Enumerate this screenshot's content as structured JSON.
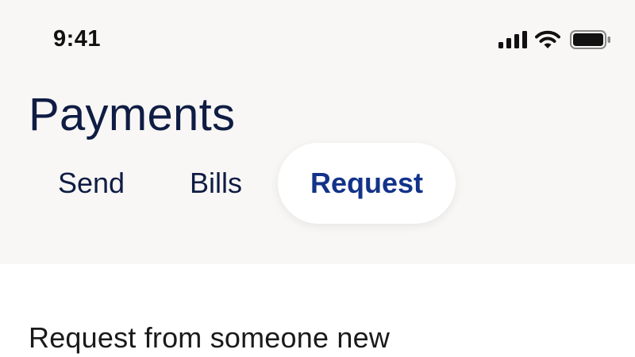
{
  "status_bar": {
    "time": "9:41",
    "icons": [
      "signal-icon",
      "wifi-icon",
      "battery-icon"
    ]
  },
  "header": {
    "title": "Payments"
  },
  "tabs": [
    {
      "label": "Send",
      "selected": false
    },
    {
      "label": "Bills",
      "selected": false
    },
    {
      "label": "Request",
      "selected": true
    }
  ],
  "section": {
    "title": "Request from someone new"
  },
  "colors": {
    "header_background": "#f8f7f5",
    "page_background": "#ffffff",
    "title_text": "#0f1d44",
    "active_tab_text": "#13338a",
    "active_tab_background": "#ffffff"
  }
}
